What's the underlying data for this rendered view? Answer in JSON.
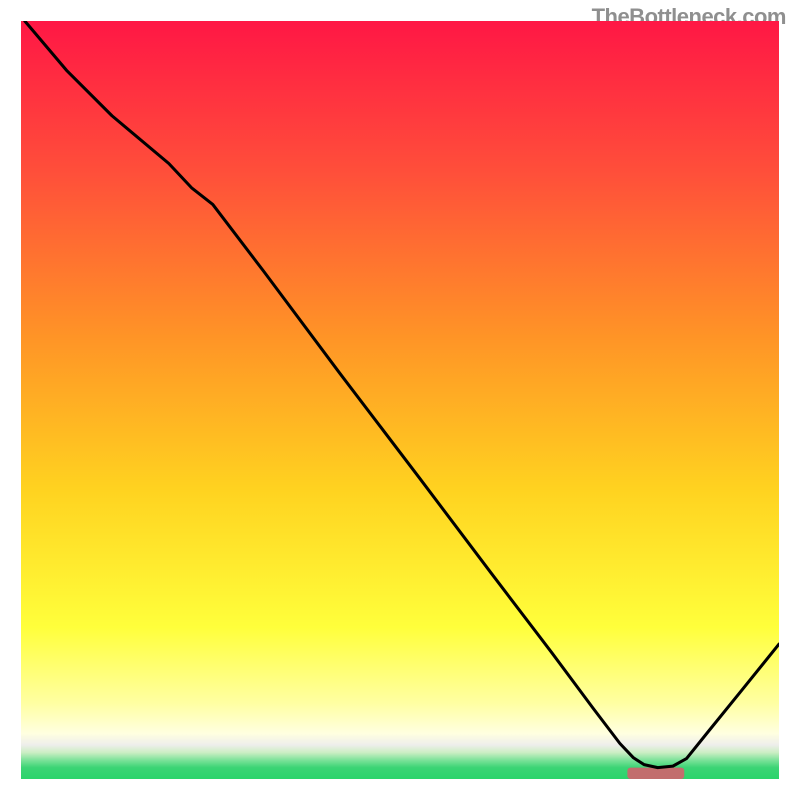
{
  "watermark": "TheBottleneck.com",
  "colors": {
    "tickGreen": "#2bd46b",
    "lineBlack": "#000000"
  },
  "chart_data": {
    "type": "line",
    "title": "",
    "xlabel": "",
    "ylabel": "",
    "xlim": [
      0,
      1000
    ],
    "ylim": [
      0,
      1000
    ],
    "x_tick_range": [
      800,
      875
    ],
    "gradient_stops": [
      {
        "offset": 0.0,
        "color": "#ff1745"
      },
      {
        "offset": 0.2,
        "color": "#ff4f3a"
      },
      {
        "offset": 0.42,
        "color": "#ff9526"
      },
      {
        "offset": 0.62,
        "color": "#ffd320"
      },
      {
        "offset": 0.8,
        "color": "#ffff3b"
      },
      {
        "offset": 0.9,
        "color": "#ffffa2"
      },
      {
        "offset": 0.94,
        "color": "#ffffe0"
      },
      {
        "offset": 0.955,
        "color": "#eeeeeb"
      },
      {
        "offset": 0.965,
        "color": "#cceec4"
      },
      {
        "offset": 0.975,
        "color": "#7de29a"
      },
      {
        "offset": 0.985,
        "color": "#3bd475"
      },
      {
        "offset": 1.0,
        "color": "#2bd46b"
      }
    ],
    "series": [
      {
        "name": "curve",
        "points": [
          {
            "x": 5,
            "y": 1000
          },
          {
            "x": 60,
            "y": 935
          },
          {
            "x": 120,
            "y": 875
          },
          {
            "x": 195,
            "y": 812
          },
          {
            "x": 225,
            "y": 780
          },
          {
            "x": 253,
            "y": 758
          },
          {
            "x": 320,
            "y": 670
          },
          {
            "x": 420,
            "y": 536
          },
          {
            "x": 525,
            "y": 398
          },
          {
            "x": 620,
            "y": 272
          },
          {
            "x": 700,
            "y": 167
          },
          {
            "x": 755,
            "y": 93
          },
          {
            "x": 790,
            "y": 47
          },
          {
            "x": 808,
            "y": 28
          },
          {
            "x": 822,
            "y": 19
          },
          {
            "x": 840,
            "y": 15
          },
          {
            "x": 860,
            "y": 17
          },
          {
            "x": 878,
            "y": 27
          },
          {
            "x": 907,
            "y": 63
          },
          {
            "x": 950,
            "y": 116
          },
          {
            "x": 1000,
            "y": 178
          }
        ]
      }
    ]
  }
}
